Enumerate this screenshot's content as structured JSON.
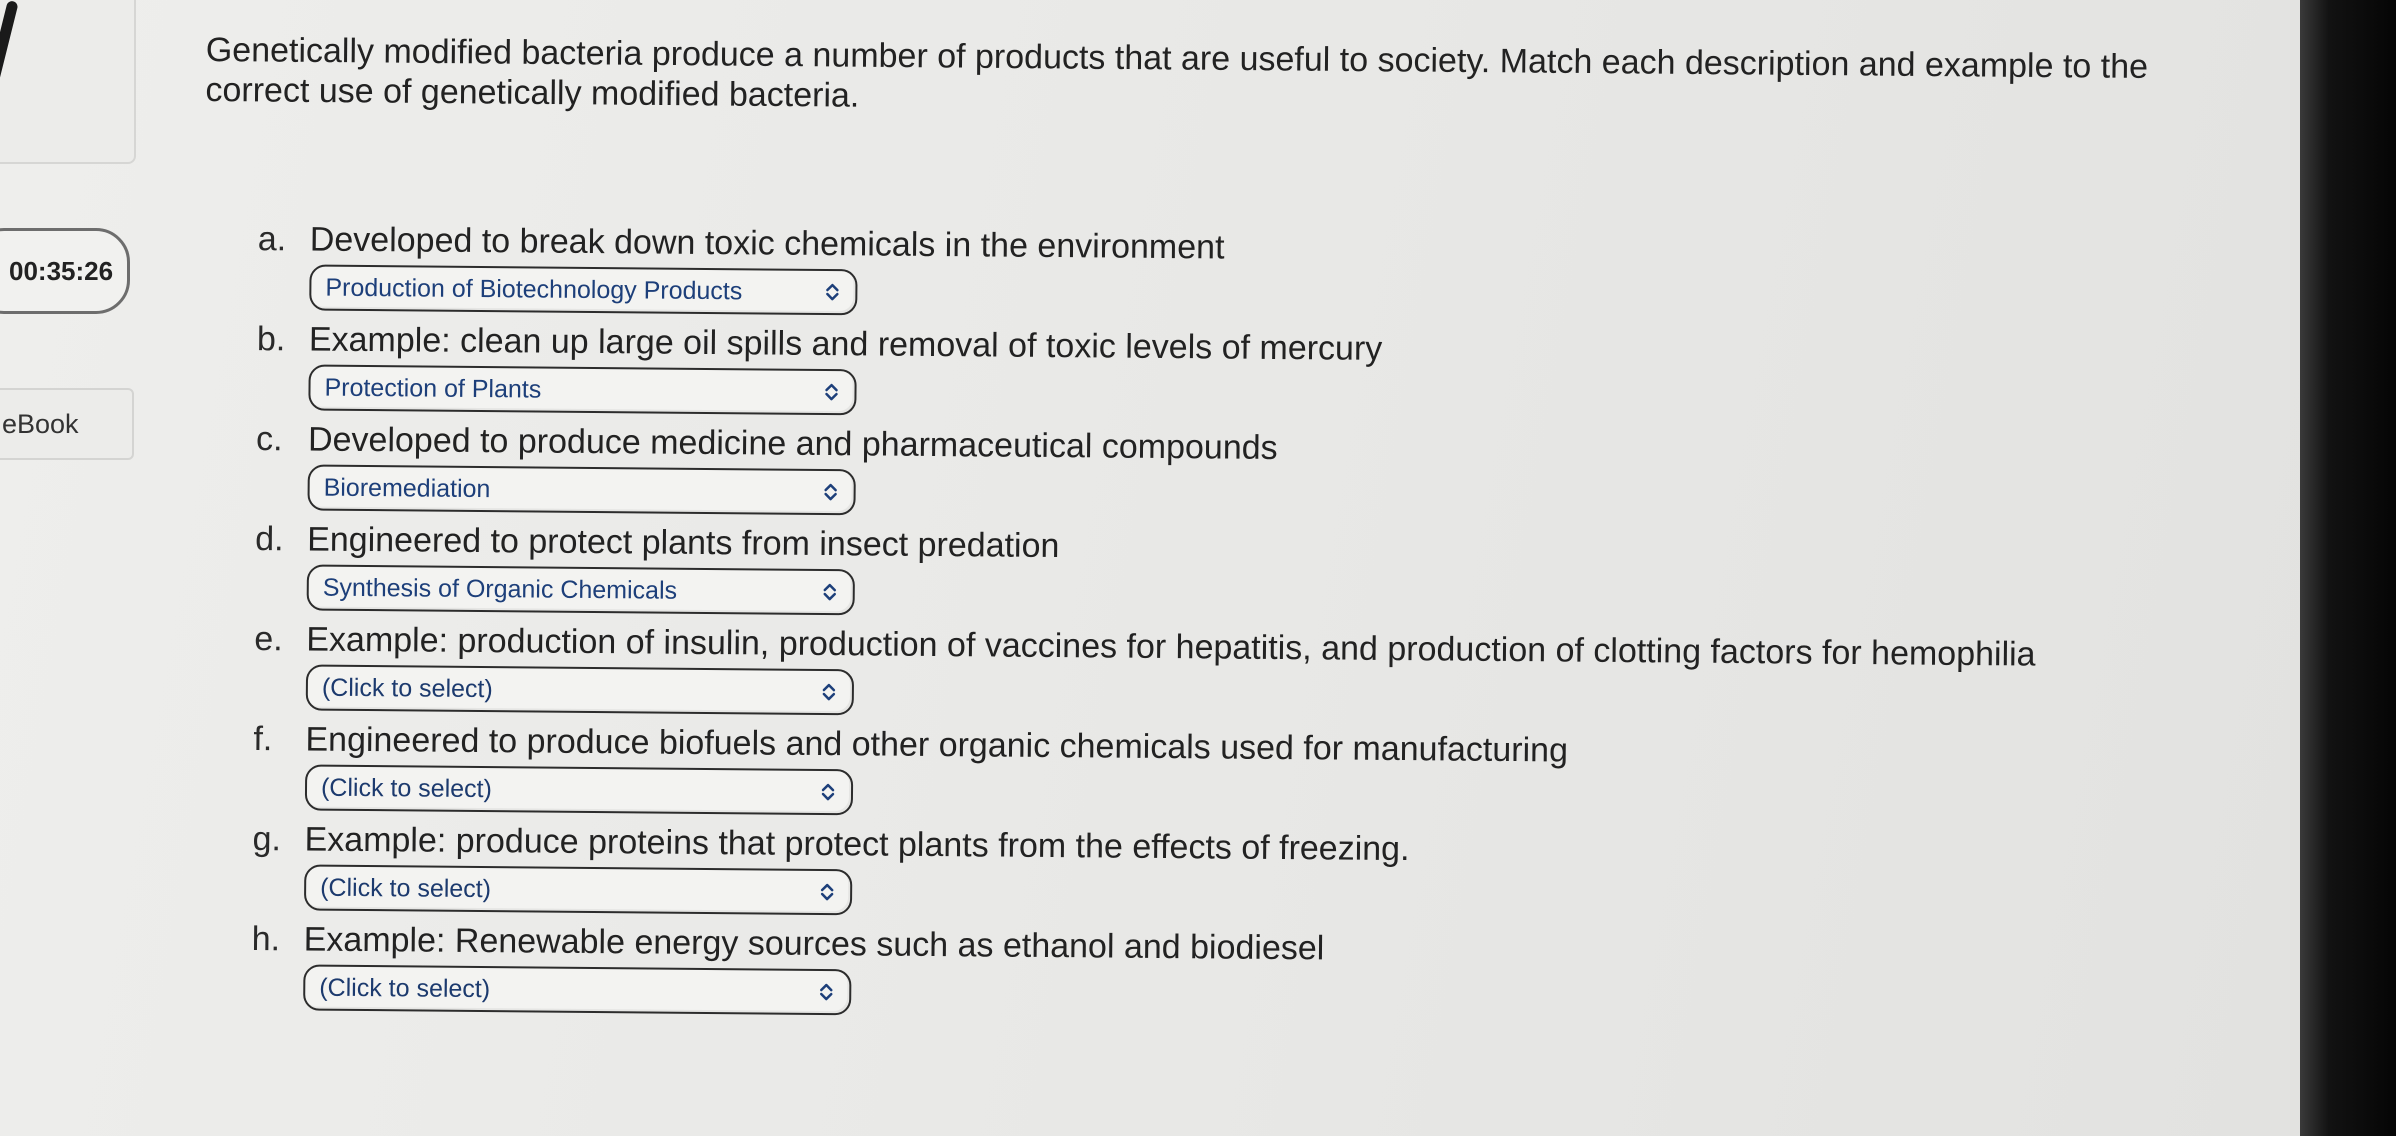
{
  "sidebar": {
    "timer": "00:35:26",
    "ebook_label": "eBook"
  },
  "question": {
    "prompt": "Genetically modified bacteria produce a number of products that are useful to society. Match each description and example to the correct use of genetically modified bacteria."
  },
  "items": [
    {
      "letter": "a.",
      "text": "Developed to break down toxic chemicals in the environment",
      "selected": "Production of Biotechnology Products"
    },
    {
      "letter": "b.",
      "text": "Example: clean up large oil spills and removal of toxic levels of mercury",
      "selected": "Protection of Plants"
    },
    {
      "letter": "c.",
      "text": "Developed to produce medicine and pharmaceutical compounds",
      "selected": "Bioremediation"
    },
    {
      "letter": "d.",
      "text": "Engineered to protect plants from insect predation",
      "selected": "Synthesis of Organic Chemicals"
    },
    {
      "letter": "e.",
      "text": "Example: production of insulin, production of vaccines for hepatitis, and production of clotting factors for hemophilia",
      "selected": "(Click to select)"
    },
    {
      "letter": "f.",
      "text": "Engineered to produce biofuels and other organic chemicals used for manufacturing",
      "selected": "(Click to select)"
    },
    {
      "letter": "g.",
      "text": "Example: produce proteins that protect plants from the effects of freezing.",
      "selected": "(Click to select)"
    },
    {
      "letter": "h.",
      "text": "Example: Renewable energy sources such as ethanol and biodiesel",
      "selected": "(Click to select)"
    }
  ],
  "icons": {
    "select_arrow": "chevron-up-down-icon"
  },
  "colors": {
    "select_text": "#1d3f7a",
    "select_border": "#2c2c2c",
    "background": "#e9e9e7"
  }
}
